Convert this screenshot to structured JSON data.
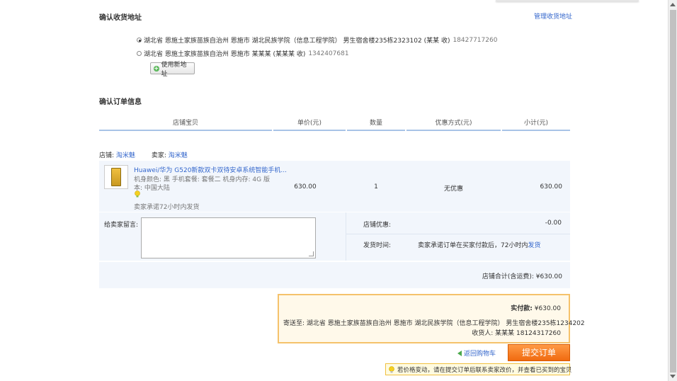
{
  "address_section": {
    "title": "确认收货地址",
    "manage_link": "管理收货地址",
    "addresses": [
      {
        "text": "湖北省 恩施土家族苗族自治州 恩施市 湖北民族学院（信息工程学院） 男生宿舍楼235栋2323102 (某某 收)",
        "phone": "18427717260",
        "selected": true
      },
      {
        "text": "湖北省 恩施土家族苗族自治州 恩施市 某某某 (某某某 收)",
        "phone": "1342407681",
        "selected": false
      }
    ],
    "new_address_button": "使用新地址"
  },
  "order_section": {
    "title": "确认订单信息",
    "columns": [
      "店铺宝贝",
      "单价(元)",
      "数量",
      "优惠方式(元)",
      "小计(元)"
    ],
    "shop_label": "店铺:",
    "shop_name": "淘米魅",
    "seller_label": "卖家:",
    "seller_name": "淘米魅",
    "product": {
      "title": "Huawei/华为 G520新款双卡双待安卓系统智能手机...",
      "attrs_line1": "机身颜色: 黑  手机套餐: 套餐二  机身内存: 4G  版",
      "attrs_line2": "本: 中国大陆",
      "promise": "卖家承诺72小时内发货",
      "unit_price": "630.00",
      "quantity": "1",
      "discount": "无优惠",
      "subtotal": "630.00"
    },
    "message_label": "给卖家留言:",
    "shop_discount_label": "店铺优惠:",
    "shop_discount_value": "-0.00",
    "ship_time_label": "发货时间:",
    "ship_time_text": "卖家承诺订单在买家付款后，72小时内",
    "ship_time_link": "发货",
    "shop_total_label": "店铺合计(含运费):",
    "shop_total_value": "¥630.00"
  },
  "summary": {
    "paid_label": "实付款:",
    "paid_value": "¥630.00",
    "ship_to_label": "寄送至:",
    "ship_to_text": "湖北省 恩施土家族苗族自治州 恩施市 湖北民族学院（信息工程学院） 男生宿舍楼235栋1234202",
    "receiver_label": "收货人:",
    "receiver_text": "某某某 18124317260",
    "back_link": "返回购物车",
    "submit_button": "提交订单",
    "notice": "若价格变动，请在提交订单后联系卖家改价，并查看已买到的宝贝"
  },
  "colors": {
    "link": "#3366cc",
    "accent_orange": "#f06a10",
    "column_line": "#a8c3e6",
    "band_bg": "#f2f6fc"
  }
}
